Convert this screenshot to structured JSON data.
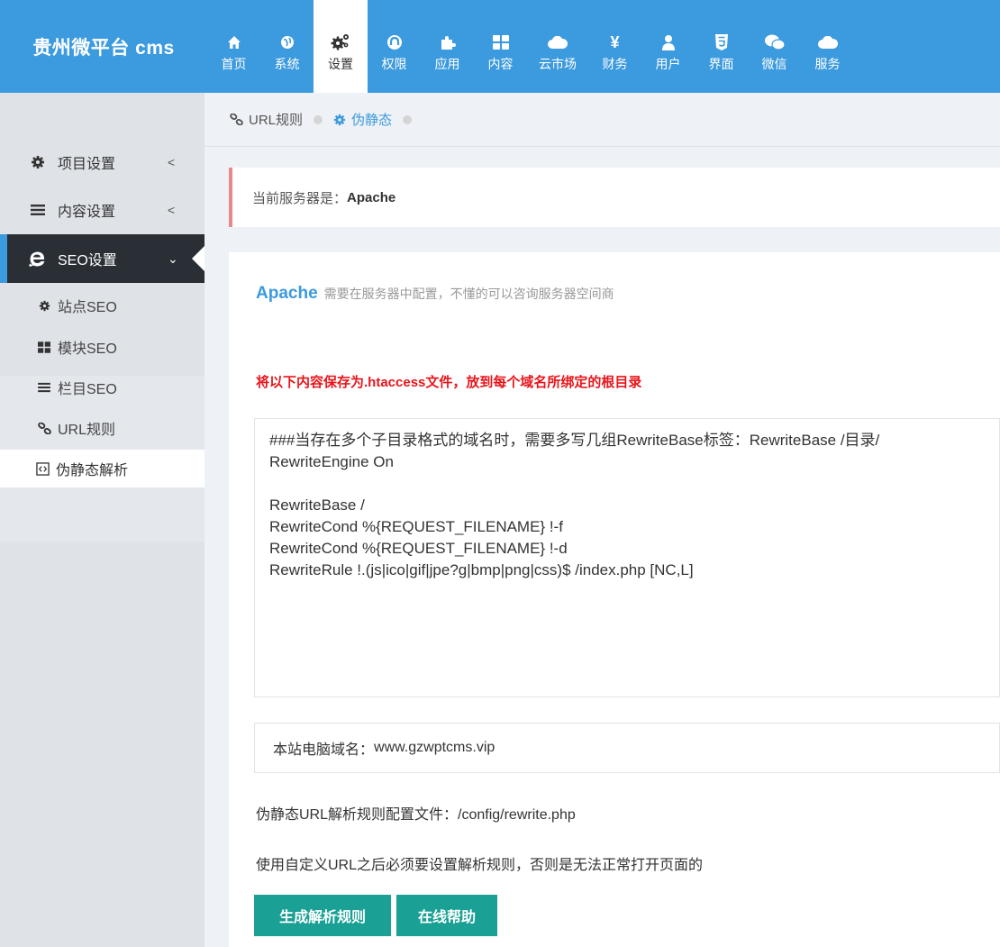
{
  "app": {
    "title": "贵州微平台 cms"
  },
  "nav": [
    {
      "label": "首页",
      "icon": "home-icon"
    },
    {
      "label": "系统",
      "icon": "globe-icon"
    },
    {
      "label": "设置",
      "icon": "gears-icon",
      "active": true
    },
    {
      "label": "权限",
      "icon": "shield-icon"
    },
    {
      "label": "应用",
      "icon": "puzzle-icon"
    },
    {
      "label": "内容",
      "icon": "grid-icon"
    },
    {
      "label": "云市场",
      "icon": "cloud-icon"
    },
    {
      "label": "财务",
      "icon": "yen-icon"
    },
    {
      "label": "用户",
      "icon": "user-icon"
    },
    {
      "label": "界面",
      "icon": "html5-icon"
    },
    {
      "label": "微信",
      "icon": "wechat-icon"
    },
    {
      "label": "服务",
      "icon": "cloud-icon"
    }
  ],
  "sidebar": {
    "groups": [
      {
        "label": "项目设置",
        "icon": "gear-icon",
        "arrow": "<"
      },
      {
        "label": "内容设置",
        "icon": "bars-icon",
        "arrow": "<"
      },
      {
        "label": "SEO设置",
        "icon": "ie-icon",
        "arrow": "⌄"
      }
    ],
    "sub_items": [
      {
        "label": "站点SEO",
        "icon": "gear-icon"
      },
      {
        "label": "模块SEO",
        "icon": "grid-icon"
      },
      {
        "label": "栏目SEO",
        "icon": "bars-icon"
      },
      {
        "label": "URL规则",
        "icon": "link-icon"
      },
      {
        "label": "伪静态解析",
        "icon": "code-icon"
      }
    ]
  },
  "breadcrumb": {
    "first": "URL规则",
    "second": "伪静态"
  },
  "alert": {
    "prefix": "当前服务器是：",
    "server": "Apache"
  },
  "panel": {
    "server_name": "Apache",
    "server_hint": "需要在服务器中配置，不懂的可以咨询服务器空间商",
    "warning": "将以下内容保存为.htaccess文件，放到每个域名所绑定的根目录",
    "code": "###当存在多个子目录格式的域名时，需要多写几组RewriteBase标签：RewriteBase /目录/\nRewriteEngine On\n\nRewriteBase /\nRewriteCond %{REQUEST_FILENAME} !-f\nRewriteCond %{REQUEST_FILENAME} !-d\nRewriteRule !.(js|ico|gif|jpe?g|bmp|png|css)$ /index.php [NC,L]",
    "domain_label": "本站电脑域名：",
    "domain_value": "www.gzwptcms.vip",
    "config_file_text": "伪静态URL解析规则配置文件：/config/rewrite.php",
    "notice_text": "使用自定义URL之后必须要设置解析规则，否则是无法正常打开页面的",
    "btn_generate": "生成解析规则",
    "btn_help": "在线帮助"
  },
  "colors": {
    "header": "#3c9ade",
    "sidebar": "#dfe3e8",
    "sidebar_active": "#2a2f36",
    "button": "#1aa094",
    "warning": "#e8151b",
    "alert_border": "#e9878b"
  }
}
